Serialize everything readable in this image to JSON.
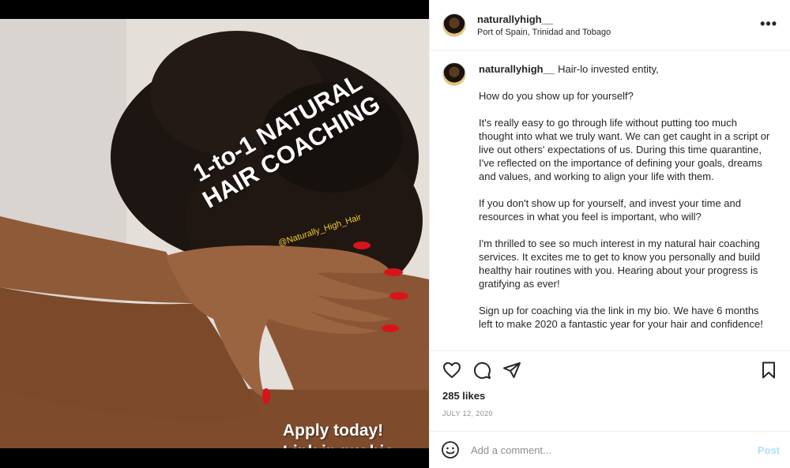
{
  "photo": {
    "overlay_title": "1-to-1 NATURAL HAIR COACHING",
    "overlay_handle": "@Naturally_High_Hair",
    "overlay_cta_line1": "Apply today!",
    "overlay_cta_line2": "Link in my bio"
  },
  "header": {
    "username": "naturallyhigh__",
    "location": "Port of Spain, Trinidad and Tobago",
    "more_icon": "more-horizontal-icon"
  },
  "caption": {
    "username": "naturallyhigh__",
    "first_line": "Hair-lo invested entity,",
    "paragraphs": [
      "How do you show up for yourself?",
      "It's really easy to go through life without putting too much thought into what we truly want. We can get caught in a script or live out others' expectations of us. During this time quarantine, I've reflected on the importance of defining your goals, dreams and values, and working to align your life with them.",
      "If you don't show up for yourself, and invest your time and resources in what you feel is important, who will?",
      "I'm thrilled to see so much interest in my natural hair coaching services. It excites me to get to know you personally and build healthy hair routines with you. Hearing about your progress is gratifying as ever!",
      "Sign up for coaching via the link in my bio. We have 6 months left to make 2020 a fantastic year for your hair and confidence!"
    ]
  },
  "actions": {
    "like_icon": "heart-icon",
    "comment_icon": "comment-icon",
    "share_icon": "send-icon",
    "save_icon": "bookmark-icon"
  },
  "likes": "285 likes",
  "date": "JULY 12, 2020",
  "comment": {
    "placeholder": "Add a comment...",
    "post_label": "Post",
    "emoji_icon": "smiley-icon"
  },
  "colors": {
    "post_disabled": "#b2dffc",
    "secondary_text": "#8e8e8e",
    "handle_yellow": "#f2cc2e",
    "nail_red": "#d8141b"
  }
}
